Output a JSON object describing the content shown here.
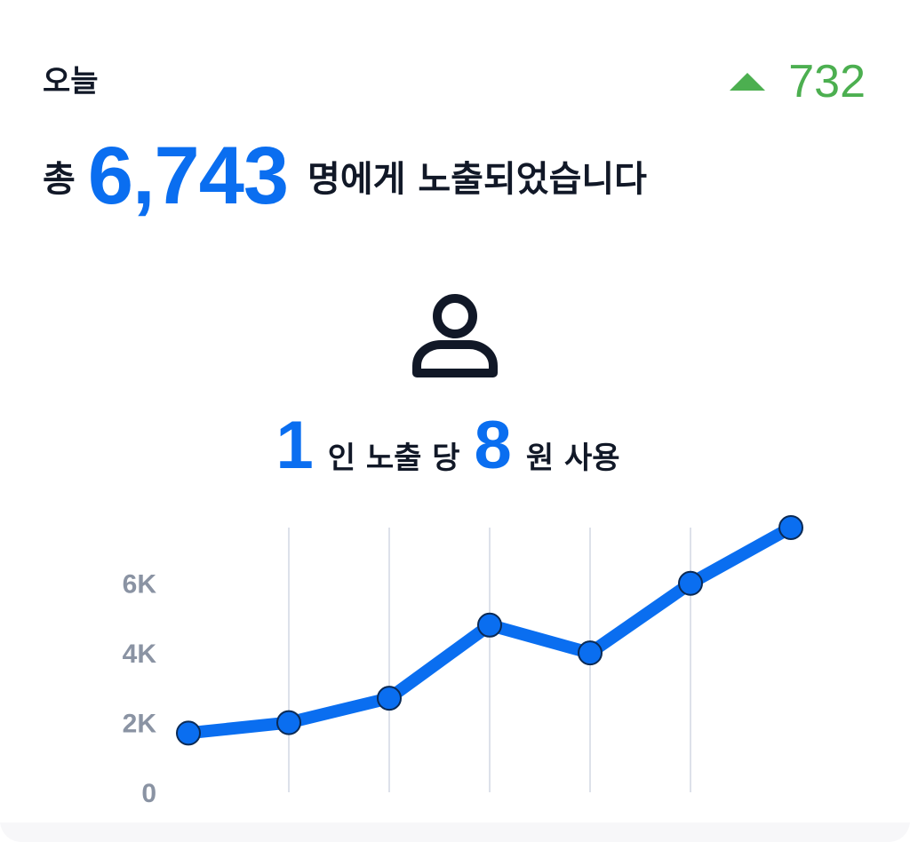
{
  "card": {
    "period_label": "오늘",
    "delta": {
      "icon": "triangle-up-icon",
      "value": "732",
      "color": "#4caf50"
    },
    "headline": {
      "prefix": "총",
      "total": "6,743",
      "suffix": "명에게 노출되었습니다"
    },
    "person_icon": "person-icon",
    "cost": {
      "people": "1",
      "mid_text": "인 노출 당",
      "amount": "8",
      "suffix": "원 사용"
    },
    "accent_color": "#0a6ef0"
  },
  "chart_data": {
    "type": "line",
    "x": [
      1,
      2,
      3,
      4,
      5,
      6,
      7
    ],
    "series": [
      {
        "values": [
          1700,
          2000,
          2700,
          4800,
          4000,
          6000,
          7600
        ]
      }
    ],
    "y_ticks": [
      "0",
      "2K",
      "4K",
      "6K"
    ],
    "y_tick_values": [
      0,
      2000,
      4000,
      6000
    ],
    "ylim": [
      0,
      7600
    ],
    "grid": "vertical",
    "color": "#0a6ef0"
  }
}
